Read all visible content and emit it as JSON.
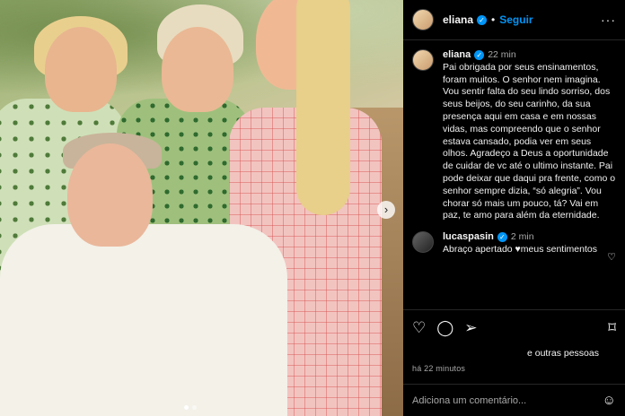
{
  "post": {
    "username": "eliana",
    "follow_label": "Seguir",
    "more_icon": "more-icon",
    "caption_time": "22 min",
    "caption": "Pai obrigada por seus ensinamentos, foram muitos. O senhor nem imagina. Vou sentir falta do seu lindo sorriso, dos seus beijos, do seu carinho, da sua presença aqui em casa e em nossas vidas, mas compreendo que o senhor estava cansado, podia ver em seus olhos. Agradeço a Deus a oportunidade de cuidar de vc até o ultimo instante. Pai pode deixar que daqui pra frente, como o senhor sempre dizia, “só alegria”. Vou chorar só mais um pouco, tá? Vai em paz, te amo para além da eternidade."
  },
  "comments": [
    {
      "username": "lucaspasin",
      "time": "2 min",
      "text": "Abraço apertado ♥meus sentimentos"
    }
  ],
  "actions": {
    "likes_text": "e outras pessoas",
    "date": "há 22 minutos"
  },
  "add_comment": {
    "placeholder": "Adiciona um comentário..."
  },
  "colors": {
    "accent": "#0095f6",
    "background": "#000000",
    "secondary_text": "#a8a8a8"
  }
}
